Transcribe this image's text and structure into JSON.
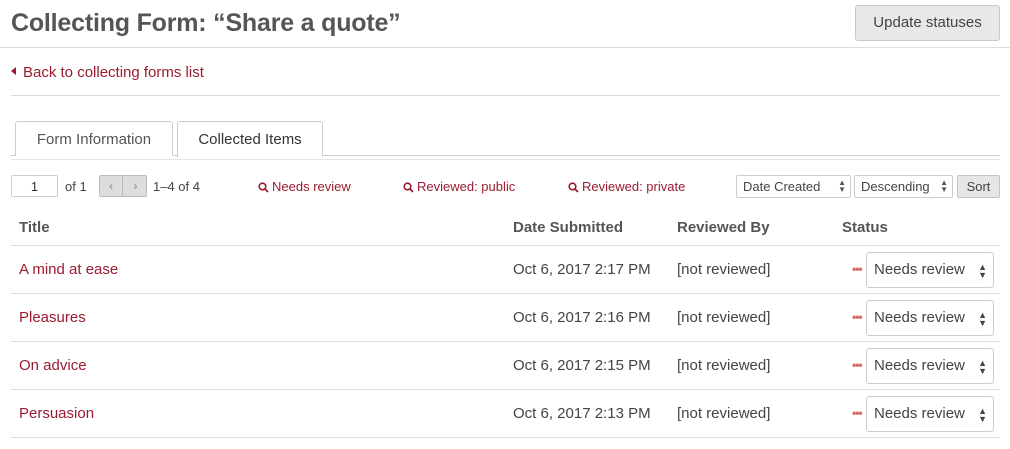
{
  "header": {
    "title": "Collecting Form: “Share a quote”",
    "update_button": "Update statuses"
  },
  "back_link": "Back to collecting forms list",
  "tabs": [
    {
      "label": "Form Information",
      "active": false
    },
    {
      "label": "Collected Items",
      "active": true
    }
  ],
  "toolbar": {
    "page_value": "1",
    "of_label": "of 1",
    "range_label": "1–4 of 4",
    "filters": [
      "Needs review",
      "Reviewed: public",
      "Reviewed: private"
    ],
    "sort_field": "Date Created",
    "sort_direction": "Descending",
    "sort_button": "Sort"
  },
  "table": {
    "headers": [
      "Title",
      "Date Submitted",
      "Reviewed By",
      "Status"
    ],
    "rows": [
      {
        "title": "A mind at ease",
        "date": "Oct 6, 2017 2:17 PM",
        "reviewed_by": "[not reviewed]",
        "status": "Needs review"
      },
      {
        "title": "Pleasures",
        "date": "Oct 6, 2017 2:16 PM",
        "reviewed_by": "[not reviewed]",
        "status": "Needs review"
      },
      {
        "title": "On advice",
        "date": "Oct 6, 2017 2:15 PM",
        "reviewed_by": "[not reviewed]",
        "status": "Needs review"
      },
      {
        "title": "Persuasion",
        "date": "Oct 6, 2017 2:13 PM",
        "reviewed_by": "[not reviewed]",
        "status": "Needs review"
      }
    ]
  },
  "colors": {
    "accent": "#9b1b30",
    "status_dots": "#d46a6a"
  },
  "icons": {
    "filter": "search-icon",
    "back": "caret-left-icon",
    "prev": "chevron-left-icon",
    "next": "chevron-right-icon"
  }
}
